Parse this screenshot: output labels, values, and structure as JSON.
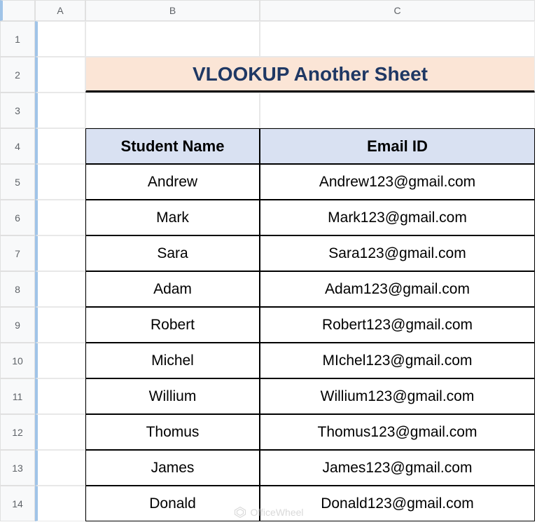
{
  "columns": [
    "A",
    "B",
    "C"
  ],
  "rows": [
    "1",
    "2",
    "3",
    "4",
    "5",
    "6",
    "7",
    "8",
    "9",
    "10",
    "11",
    "12",
    "13",
    "14"
  ],
  "title": "VLOOKUP Another Sheet",
  "table": {
    "headers": {
      "name": "Student Name",
      "email": "Email ID"
    },
    "data": [
      {
        "name": "Andrew",
        "email": "Andrew123@gmail.com"
      },
      {
        "name": "Mark",
        "email": "Mark123@gmail.com"
      },
      {
        "name": "Sara",
        "email": "Sara123@gmail.com"
      },
      {
        "name": "Adam",
        "email": "Adam123@gmail.com"
      },
      {
        "name": "Robert",
        "email": "Robert123@gmail.com"
      },
      {
        "name": "Michel",
        "email": "MIchel123@gmail.com"
      },
      {
        "name": "Willium",
        "email": "Willium123@gmail.com"
      },
      {
        "name": "Thomus",
        "email": "Thomus123@gmail.com"
      },
      {
        "name": "James",
        "email": "James123@gmail.com"
      },
      {
        "name": "Donald",
        "email": "Donald123@gmail.com"
      }
    ]
  },
  "watermark": "OfficeWheel"
}
